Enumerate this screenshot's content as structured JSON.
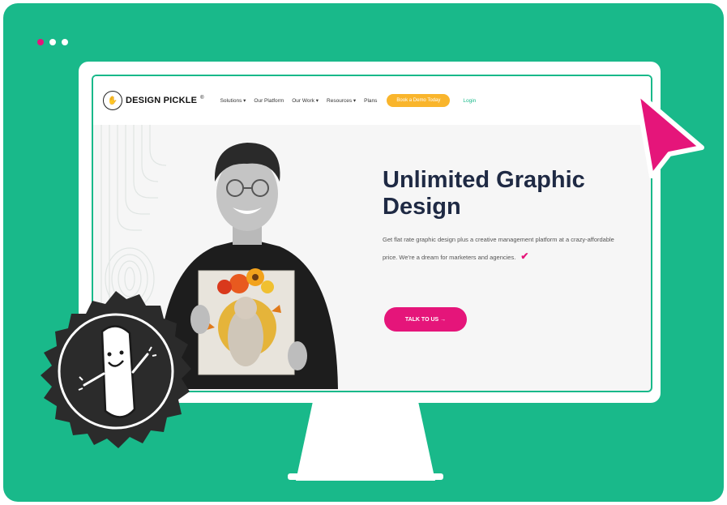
{
  "browser": {
    "dots": [
      "close",
      "minimize",
      "maximize"
    ]
  },
  "nav": {
    "logo_text": "DESIGN PICKLE",
    "logo_mark": "®",
    "menu": [
      {
        "label": "Solutions ▾"
      },
      {
        "label": "Our Platform"
      },
      {
        "label": "Our Work ▾"
      },
      {
        "label": "Resources ▾"
      },
      {
        "label": "Plans"
      }
    ],
    "book_button": "Book a Demo Today",
    "login": "Login"
  },
  "hero": {
    "title": "Unlimited Graphic Design",
    "body": "Get flat rate graphic design plus a creative management platform at a crazy-affordable price. We're a dream for marketers and agencies.",
    "check_icon": "✔",
    "cta": "TALK TO US →"
  },
  "colors": {
    "background": "#19b98a",
    "accent_pink": "#e5157a",
    "accent_yellow": "#f9b52c",
    "title_navy": "#1f2a44"
  },
  "icons": [
    "pointer-cursor-icon",
    "pickle-mascot-badge",
    "design-pickle-logo-icon"
  ]
}
